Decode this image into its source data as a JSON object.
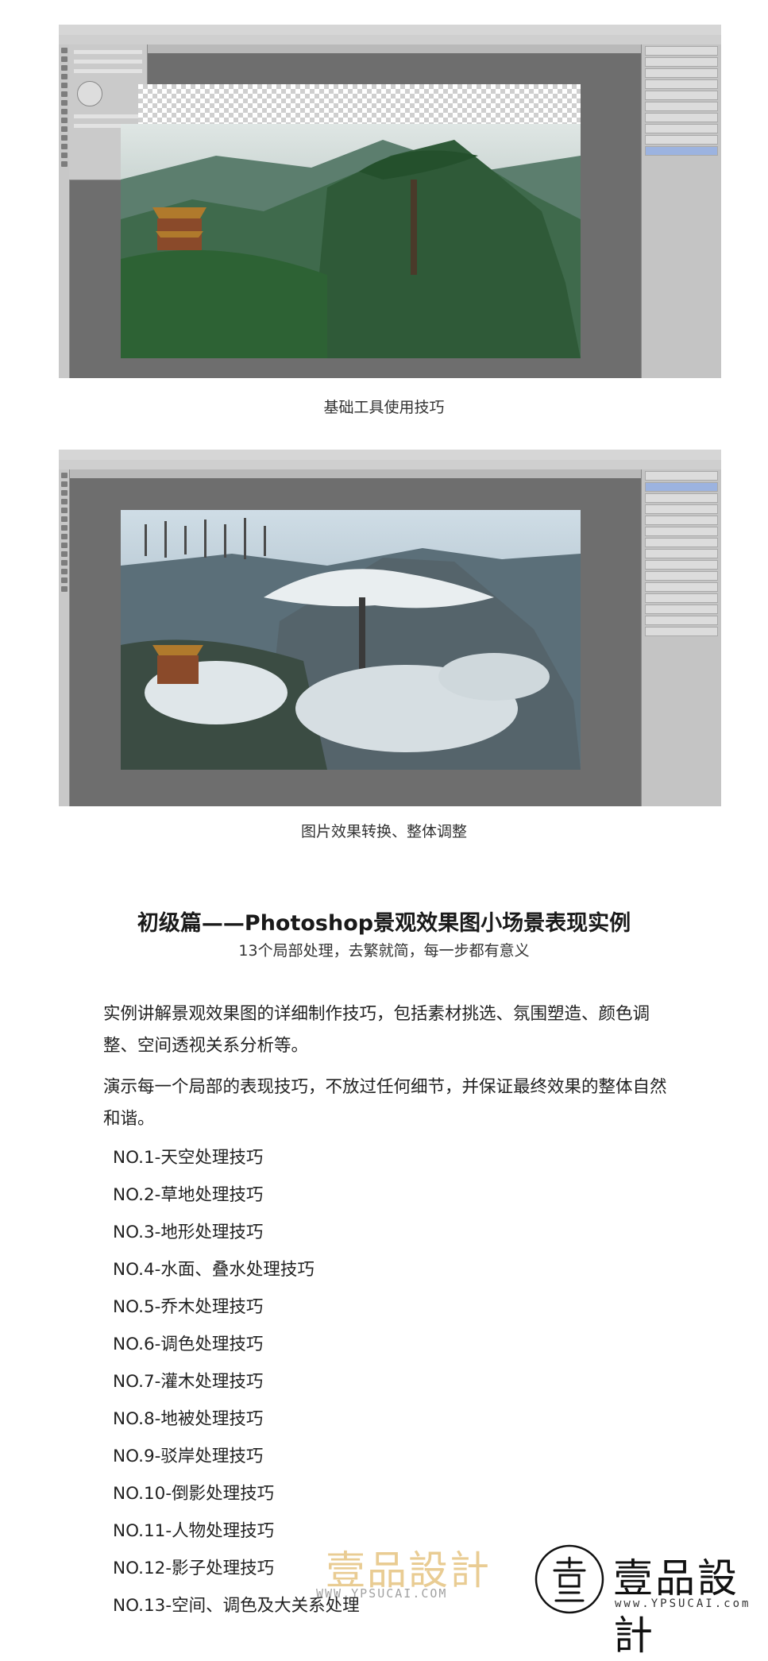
{
  "figures": [
    {
      "caption": "基础工具使用技巧"
    },
    {
      "caption": "图片效果转换、整体调整"
    }
  ],
  "heading": {
    "title": "初级篇——Photoshop景观效果图小场景表现实例",
    "subtitle": "13个局部处理，去繁就简，每一步都有意义"
  },
  "intro": {
    "p1": "实例讲解景观效果图的详细制作技巧，包括素材挑选、氛围塑造、颜色调整、空间透视关系分析等。",
    "p2": "演示每一个局部的表现技巧，不放过任何细节，并保证最终效果的整体自然和谐。"
  },
  "items": [
    "NO.1-天空处理技巧",
    "NO.2-草地处理技巧",
    "NO.3-地形处理技巧",
    "NO.4-水面、叠水处理技巧",
    "NO.5-乔木处理技巧",
    "NO.6-调色处理技巧",
    "NO.7-灌木处理技巧",
    "NO.8-地被处理技巧",
    "NO.9-驳岸处理技巧",
    "NO.10-倒影处理技巧",
    "NO.11-人物处理技巧",
    "NO.12-影子处理技巧",
    "NO.13-空间、调色及大关系处理"
  ],
  "watermarks": {
    "center_brand": "壹品設計",
    "center_url": "WWW.YPSUCAI.COM",
    "right_brand": "壹品設計",
    "right_url": "www.YPSUCAI.com",
    "brand_color": "#d8a43c"
  },
  "colors": {
    "ps_workspace": "#6e6e6e",
    "layer_selected": "#9cb3e0"
  }
}
